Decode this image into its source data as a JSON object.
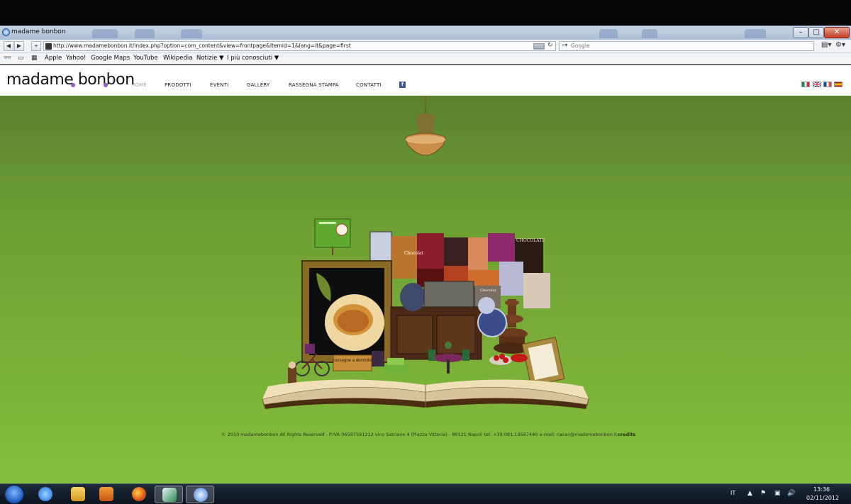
{
  "window": {
    "title": "madame bonbon"
  },
  "browser": {
    "url": "http://www.madamebonbon.it/index.php?option=com_content&view=frontpage&Itemid=1&lang=it&page=first",
    "rss_label": "RSS",
    "search_placeholder": "Google",
    "bookmarks": [
      "Apple",
      "Yahoo!",
      "Google Maps",
      "YouTube",
      "Wikipedia",
      "Notizie ▼",
      "I più conosciuti ▼"
    ]
  },
  "site": {
    "logo": "madame bonbon",
    "menu": [
      {
        "label": "HOME",
        "active": true
      },
      {
        "label": "PRODOTTI",
        "active": false
      },
      {
        "label": "EVENTI",
        "active": false
      },
      {
        "label": "GALLERY",
        "active": false
      },
      {
        "label": "RASSEGNA STAMPA",
        "active": false
      },
      {
        "label": "CONTATTI",
        "active": false
      }
    ],
    "languages": [
      "it-flag-icon",
      "uk-flag-icon",
      "fr-flag-icon",
      "es-flag-icon"
    ],
    "scene_sign": "consegne a domicilio",
    "poster_labels": [
      "Chocolat",
      "Chocolat",
      "CHOCOLATE"
    ],
    "footer": "© 2010 madamebonbon All Rights Reserved - P.IVA 06587591212    vico Satriano 4 (Piazza Vittoria) - 80121 Napoli tel. +39.081.19567440 e-mail: cacao@madamebonbon.it",
    "credits": "credits"
  },
  "taskbar": {
    "lang": "IT",
    "time": "13:36",
    "date": "02/11/2012"
  },
  "colors": {
    "bg_top": "#5a822e",
    "bg_bottom": "#86be3d",
    "logo_accent": "#8d5bbf"
  }
}
